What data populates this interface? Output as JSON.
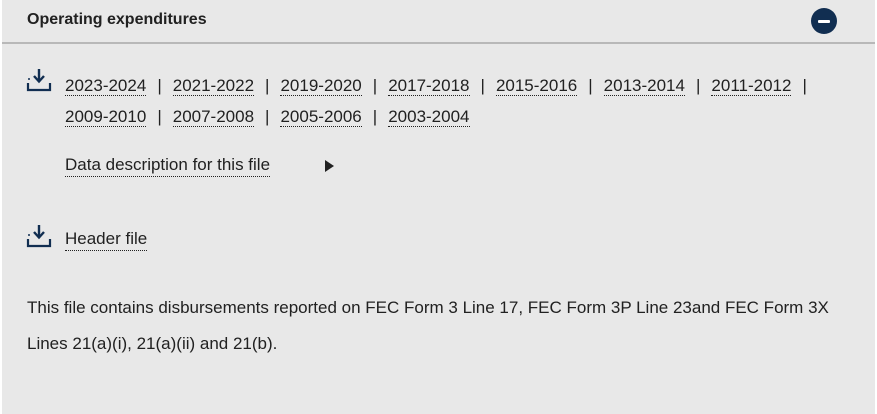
{
  "section": {
    "title": "Operating expenditures",
    "collapse_icon": "minus-circle-icon"
  },
  "downloads": {
    "icon": "download-icon",
    "years": [
      "2023-2024",
      "2021-2022",
      "2019-2020",
      "2017-2018",
      "2015-2016",
      "2013-2014",
      "2011-2012",
      "2009-2010",
      "2007-2008",
      "2005-2006",
      "2003-2004"
    ],
    "separator": "|"
  },
  "data_description": {
    "label": "Data description for this file",
    "icon": "triangle-right-icon"
  },
  "header_file": {
    "label": "Header file",
    "icon": "download-icon"
  },
  "description": "This file contains disbursements reported on FEC Form 3 Line 17, FEC Form 3P Line 23and FEC Form 3X Lines 21(a)(i), 21(a)(ii) and 21(b)."
}
